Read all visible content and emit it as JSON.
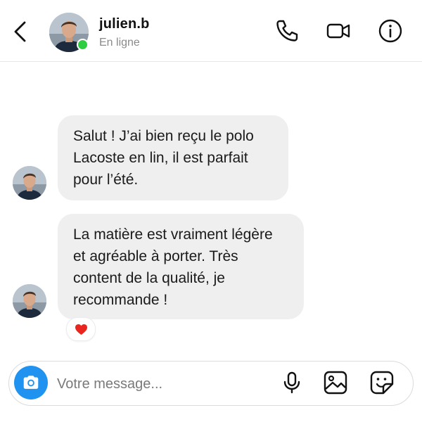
{
  "header": {
    "username": "julien.b",
    "status": "En ligne",
    "icons": [
      "back-icon",
      "phone-icon",
      "video-icon",
      "info-icon"
    ],
    "online_color": "#2ecc40"
  },
  "messages": [
    {
      "sender": "julien.b",
      "text": "Salut ! J’ai bien reçu le polo\nLacoste en lin, il est parfait\npour l’été."
    },
    {
      "sender": "julien.b",
      "text": "La matière est vraiment légère\net agréable à porter. Très\ncontent de la qualité, je\nrecommande !",
      "reaction": "❤️"
    }
  ],
  "composer": {
    "placeholder": "Votre message...",
    "icons": [
      "camera-icon",
      "microphone-icon",
      "gallery-icon",
      "sticker-icon"
    ],
    "accent": "#1f93ef"
  },
  "colors": {
    "bubble": "#efefef",
    "status_text": "#8a8a8a"
  }
}
